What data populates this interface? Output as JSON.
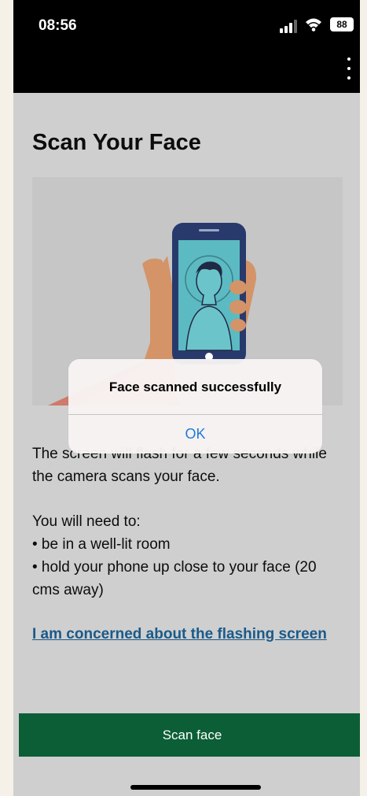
{
  "status_bar": {
    "time": "08:56",
    "battery": "88"
  },
  "page": {
    "title": "Scan Your Face",
    "body_line1": "The screen will flash for a few seconds while",
    "body_line2": "the camera scans your face.",
    "need_intro": "You will need to:",
    "bullet1": "• be in a well-lit room",
    "bullet2_line1": "• hold your phone up close to your face (20",
    "bullet2_line2": "cms away)",
    "concern_link": "I am concerned about the flashing screen",
    "scan_button": "Scan face"
  },
  "alert": {
    "title": "Face scanned successfully",
    "ok_label": "OK"
  },
  "colors": {
    "primary_button": "#0b5e36",
    "link": "#1a5a8a",
    "alert_action": "#1e7bd8"
  }
}
